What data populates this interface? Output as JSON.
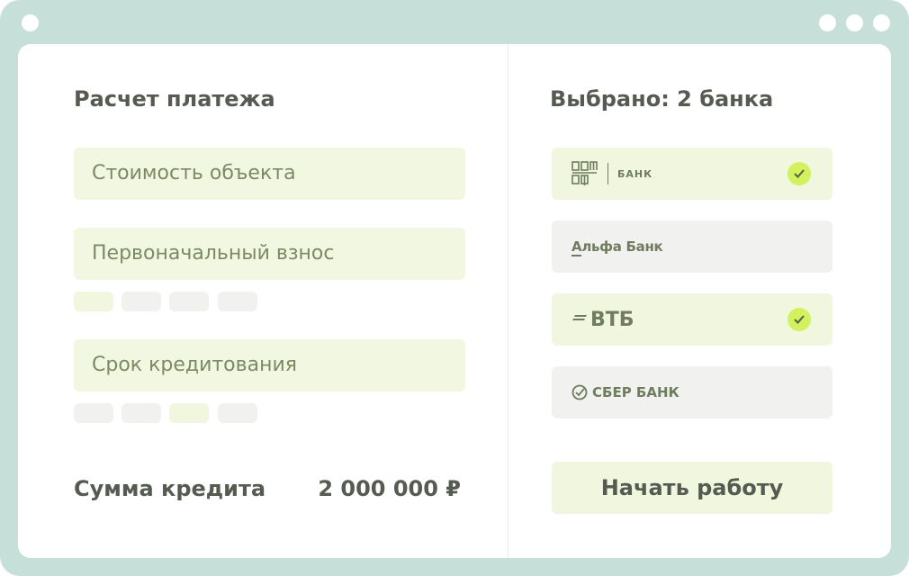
{
  "left": {
    "title": "Расчет платежа",
    "fields": [
      {
        "label": "Стоимость объекта"
      },
      {
        "label": "Первоначальный взнос"
      },
      {
        "label": "Срок кредитования"
      }
    ],
    "total_label": "Сумма кредита",
    "total_value": "2 000 000 ₽"
  },
  "right": {
    "title": "Выбрано: 2 банка",
    "banks": [
      {
        "logo": "ДОМ РФ",
        "sublabel": "БАНК",
        "selected": true
      },
      {
        "logo": "Альфа Банк",
        "selected": false
      },
      {
        "logo": "ВТБ",
        "selected": true
      },
      {
        "logo": "СБЕР БАНК",
        "selected": false
      }
    ],
    "start_button": "Начать работу"
  },
  "colors": {
    "frame": "#c6dfd9",
    "field_bg": "#f2f7e2",
    "check": "#d3f15f",
    "text": "#565b52"
  }
}
